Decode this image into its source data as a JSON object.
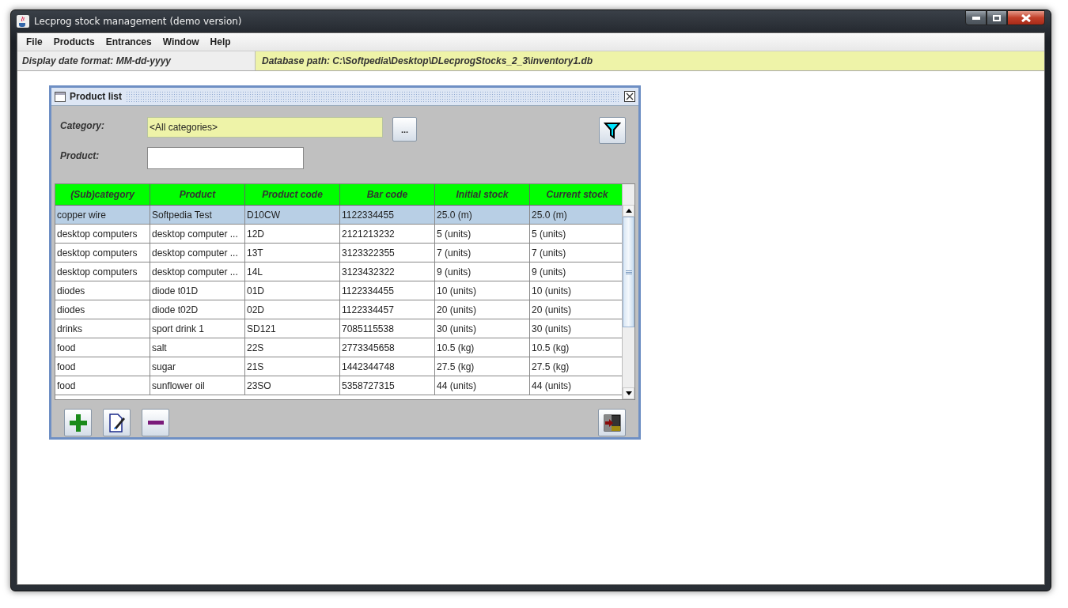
{
  "window": {
    "title": "Lecprog stock management (demo version)"
  },
  "menu": [
    "File",
    "Products",
    "Entrances",
    "Window",
    "Help"
  ],
  "info_bar": {
    "date_format": "Display date format:  MM-dd-yyyy",
    "database_path": "Database path: C:\\Softpedia\\Desktop\\DLecprogStocks_2_3\\inventory1.db"
  },
  "product_list": {
    "title": "Product list",
    "category": {
      "label": "Category:",
      "value": "<All categories>",
      "browse_button": "..."
    },
    "product": {
      "label": "Product:"
    },
    "table": {
      "columns": [
        "(Sub)category",
        "Product",
        "Product code",
        "Bar code",
        "Initial stock",
        "Current stock"
      ],
      "rows": [
        {
          "cells": [
            "copper wire",
            "Softpedia Test",
            "D10CW",
            "1122334455",
            "25.0 (m)",
            "25.0 (m)"
          ],
          "selected": true
        },
        {
          "cells": [
            "desktop computers",
            "desktop computer ...",
            "12D",
            "2121213232",
            "5 (units)",
            "5 (units)"
          ],
          "selected": false
        },
        {
          "cells": [
            "desktop computers",
            "desktop computer ...",
            "13T",
            "3123322355",
            "7 (units)",
            "7 (units)"
          ],
          "selected": false
        },
        {
          "cells": [
            "desktop computers",
            "desktop computer ...",
            "14L",
            "3123432322",
            "9 (units)",
            "9 (units)"
          ],
          "selected": false
        },
        {
          "cells": [
            "diodes",
            "diode t01D",
            "01D",
            "1122334455",
            "10 (units)",
            "10 (units)"
          ],
          "selected": false
        },
        {
          "cells": [
            "diodes",
            "diode t02D",
            "02D",
            "1122334457",
            "20 (units)",
            "20 (units)"
          ],
          "selected": false
        },
        {
          "cells": [
            "drinks",
            "sport drink 1",
            "SD121",
            "7085115538",
            "30 (units)",
            "30 (units)"
          ],
          "selected": false
        },
        {
          "cells": [
            "food",
            "salt",
            "22S",
            "2773345658",
            "10.5 (kg)",
            "10.5 (kg)"
          ],
          "selected": false
        },
        {
          "cells": [
            "food",
            "sugar",
            "21S",
            "1442344748",
            "27.5 (kg)",
            "27.5 (kg)"
          ],
          "selected": false
        },
        {
          "cells": [
            "food",
            "sunflower oil",
            "23SO",
            "5358727315",
            "44 (units)",
            "44 (units)"
          ],
          "selected": false
        }
      ]
    }
  }
}
